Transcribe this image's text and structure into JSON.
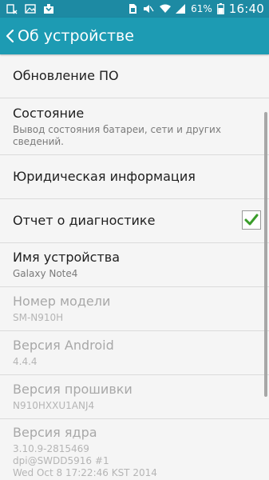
{
  "status_bar": {
    "battery_percent": "61%",
    "time": "16:40",
    "icons": [
      "notification-icon",
      "image-icon",
      "download-icon",
      "sim-icon",
      "mute-icon",
      "wifi-icon",
      "signal-icon",
      "battery-icon"
    ]
  },
  "action_bar": {
    "title": "Об устройстве"
  },
  "colors": {
    "status_bar": "#1d8aa3",
    "action_bar": "#1d9bb3",
    "check_green": "#3a9d2a"
  },
  "items": [
    {
      "title": "Обновление ПО"
    },
    {
      "title": "Состояние",
      "summary": "Вывод состояния батареи, сети и других сведений."
    },
    {
      "title": "Юридическая информация"
    },
    {
      "title": "Отчет о диагностике",
      "checked": true
    },
    {
      "title": "Имя устройства",
      "summary": "Galaxy Note4"
    },
    {
      "title": "Номер модели",
      "summary": "SM-N910H"
    },
    {
      "title": "Версия Android",
      "summary": "4.4.4"
    },
    {
      "title": "Версия прошивки",
      "summary": "N910HXXU1ANJ4"
    },
    {
      "title": "Версия ядра",
      "summary_lines": [
        "3.10.9-2815469",
        "dpi@SWDD5916 #1",
        "Wed Oct 8 17:22:46 KST 2014"
      ]
    }
  ]
}
